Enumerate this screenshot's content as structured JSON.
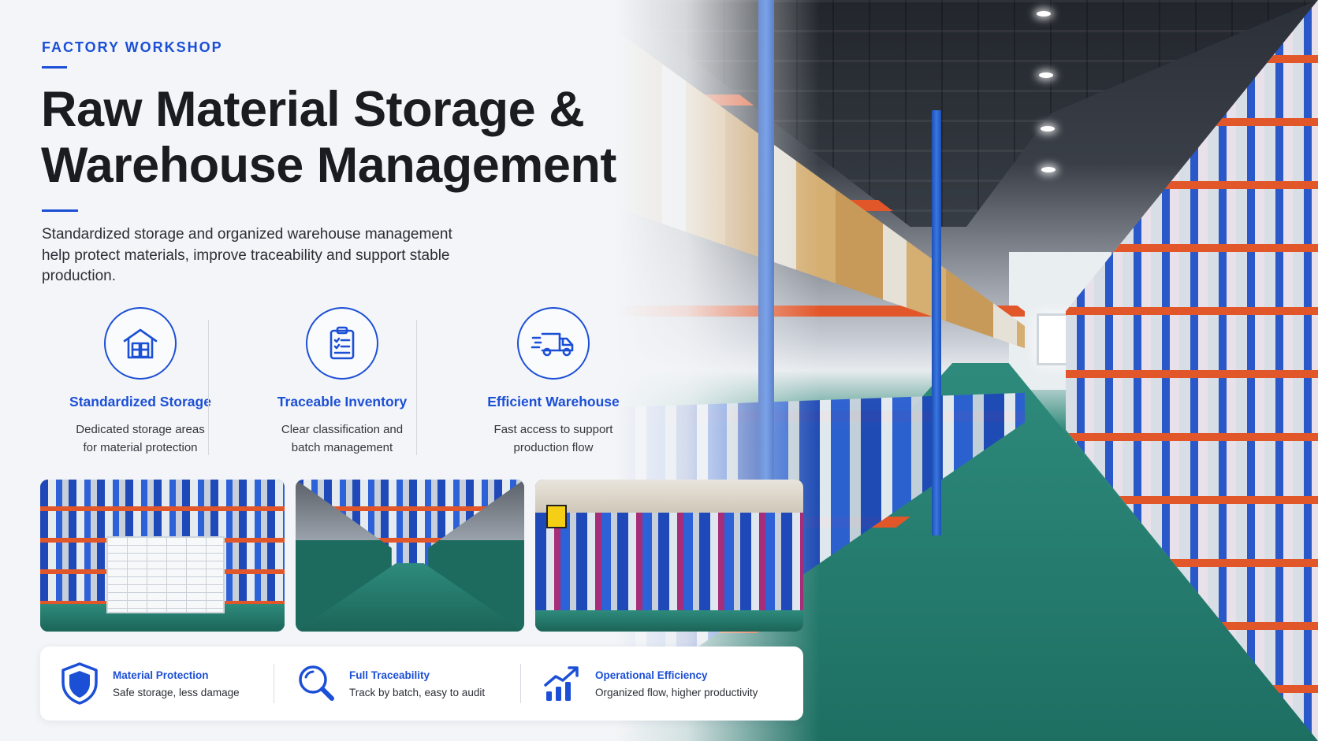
{
  "header": {
    "eyebrow": "FACTORY WORKSHOP",
    "title_line1": "Raw Material Storage &",
    "title_line2": "Warehouse Management",
    "description": "Standardized storage and organized warehouse management help protect materials, improve traceability and support stable production."
  },
  "features": [
    {
      "icon": "warehouse-icon",
      "title": "Standardized Storage",
      "line1": "Dedicated storage areas",
      "line2": "for material protection"
    },
    {
      "icon": "clipboard-icon",
      "title": "Traceable Inventory",
      "line1": "Clear classification and",
      "line2": "batch management"
    },
    {
      "icon": "delivery-truck-icon",
      "title": "Efficient Warehouse",
      "line1": "Fast access to support",
      "line2": "production flow"
    }
  ],
  "photos": [
    "warehouse-board-photo",
    "warehouse-aisle-photo",
    "material-rolls-photo"
  ],
  "benefits": [
    {
      "icon": "shield-icon",
      "title": "Material Protection",
      "text": "Safe storage, less damage"
    },
    {
      "icon": "magnifier-icon",
      "title": "Full Traceability",
      "text": "Track by batch, easy to audit"
    },
    {
      "icon": "growth-chart-icon",
      "title": "Operational Efficiency",
      "text": "Organized flow, higher productivity"
    }
  ],
  "colors": {
    "accent": "#1b4fd6",
    "text": "#1a1c21",
    "background": "#f3f5f8"
  }
}
